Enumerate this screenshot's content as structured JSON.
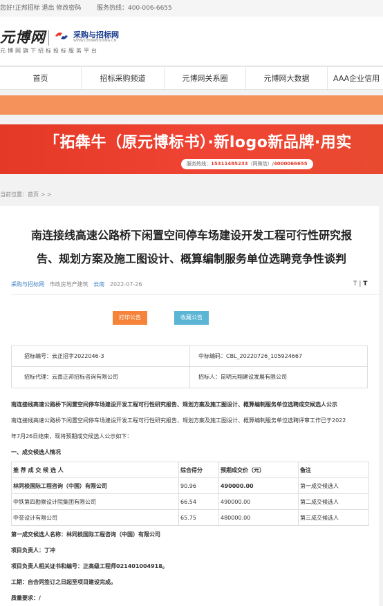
{
  "topbar": {
    "links": "您好!正邦招标 退出 修改密码",
    "hotline": "服务热线：400-006-6655"
  },
  "header": {
    "logo_main": "元博网",
    "logo_cn": "采购与招标网",
    "logo_en": "WWW.CHINABIDDING.CN",
    "logo_sub": "元博网旗下招标投标服务平台"
  },
  "nav": {
    "items": [
      {
        "label": "首页"
      },
      {
        "label": "招标采购频道"
      },
      {
        "label": "元博网关系圈"
      },
      {
        "label": "元博网大数据"
      },
      {
        "label": "AAA企业信用"
      }
    ]
  },
  "banner": {
    "headline": "「拓犇牛（原元博标书）·新logo新品牌·用实",
    "hotline_label": "服务热线：",
    "hotline_num1": "15311485233",
    "hotline_note": "（同微信）/",
    "hotline_num2": "4000066655"
  },
  "breadcrumb": "当前位置：首页 > >",
  "article": {
    "title_line1": "南连接线高速公路桥下闲置空间停车场建设开发工程可行性研究报",
    "title_line2": "告、规划方案及施工图设计、概算编制服务单位选聘竞争性谈判",
    "meta_source": "采购与招标网",
    "meta_category": "市政房地产建筑",
    "meta_location": "云南",
    "meta_date": "2022-07-26",
    "fontsize_small": "T",
    "fontsize_large": "T",
    "print_button": "打印公告",
    "fav_button": "收藏公告"
  },
  "info": {
    "bid_no": "招标编号：云正招字2022046-3",
    "win_no": "中标编码：CBL_20220726_105924667",
    "agent": "招标代理：云南正邦招标咨询有限公司",
    "tenderer": "招标人：昆明元翔建设发展有限公司"
  },
  "content": {
    "heading": "南连接线高速公路桥下闲置空间停车场建设开发工程可行性研究报告、规划方案及施工图设计、概算编制服务单位选聘成交候选人公示",
    "para_line1": "南连接线高速公路桥下闲置空间停车场建设开发工程可行性研究报告、规划方案及施工图设计、概算编制服务单位选聘评审工作已于2022",
    "para_line2": "年7月26日结束，现将预期成交候选人公示如下：",
    "section1": "一、成交候选人情况",
    "table_headers": [
      "推 荐 成 交 候 选 人",
      "综合得分",
      "预期成交价（元）",
      "备注"
    ],
    "table_rows": [
      [
        "林同棪国际工程咨询（中国）有限公司",
        "90.96",
        "490000.00",
        "第一成交候选人"
      ],
      [
        "中铁第四勘察设计院集团有限公司",
        "66.54",
        "490000.00",
        "第二成交候选人"
      ],
      [
        "中誉设计有限公司",
        "65.75",
        "480000.00",
        "第三成交候选人"
      ]
    ],
    "first_candidate": "第一成交候选人名称：林同棪国际工程咨询（中国）有限公司",
    "project_leader": "项目负责人：丁冲",
    "leader_cert": "项目负责人相关证书和编号：正高级工程师021401004918。",
    "duration": "工期：自合同签订之日起至项目建设完成。",
    "quality": "质量要求：/"
  },
  "colors": {
    "nav_orange": "#f5925c",
    "banner_red": "#e53927",
    "print_btn": "#f5833a",
    "fav_btn": "#5bb5d5",
    "link_blue": "#3a7fc0"
  }
}
